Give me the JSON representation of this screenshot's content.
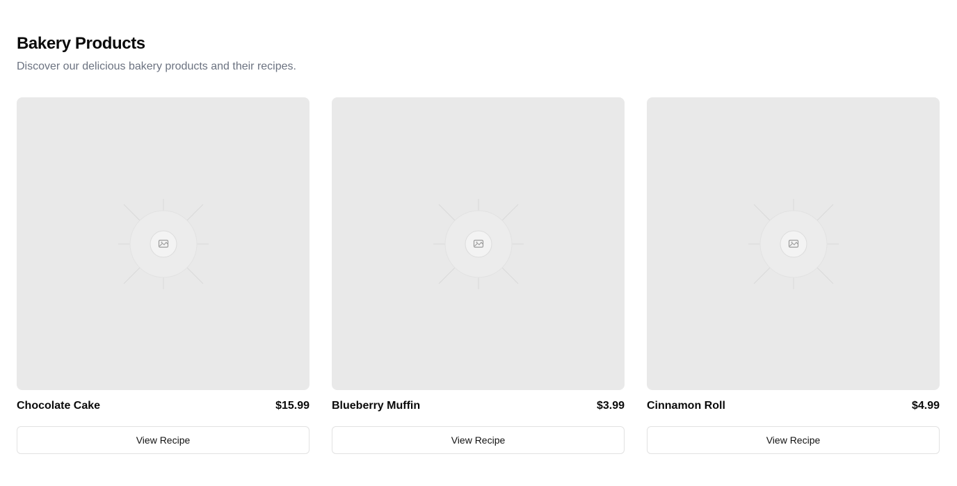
{
  "header": {
    "title": "Bakery Products",
    "subtitle": "Discover our delicious bakery products and their recipes."
  },
  "products": [
    {
      "name": "Chocolate Cake",
      "price": "$15.99",
      "button_label": "View Recipe",
      "image_icon": "image-placeholder-icon"
    },
    {
      "name": "Blueberry Muffin",
      "price": "$3.99",
      "button_label": "View Recipe",
      "image_icon": "image-placeholder-icon"
    },
    {
      "name": "Cinnamon Roll",
      "price": "$4.99",
      "button_label": "View Recipe",
      "image_icon": "image-placeholder-icon"
    }
  ],
  "colors": {
    "placeholder_bg": "#e9e9e9",
    "subtitle": "#6b7280",
    "button_border": "#e2e2e2"
  }
}
